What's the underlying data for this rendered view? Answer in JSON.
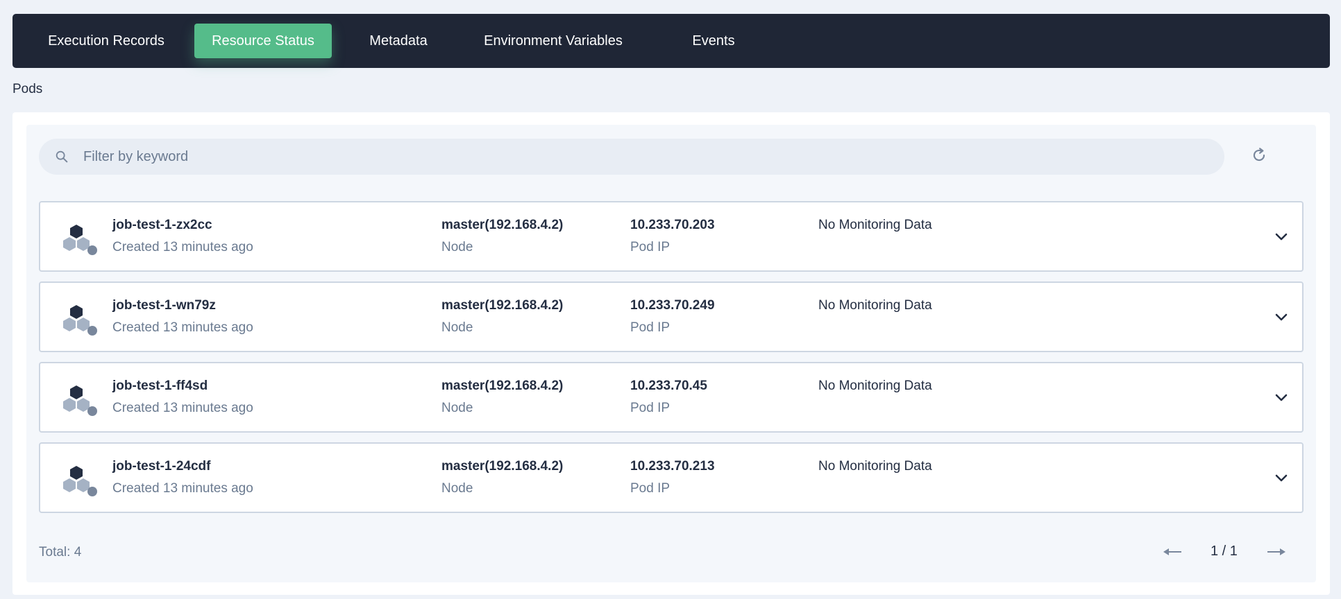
{
  "tabs": [
    {
      "label": "Execution Records"
    },
    {
      "label": "Resource Status"
    },
    {
      "label": "Metadata"
    },
    {
      "label": "Environment Variables"
    },
    {
      "label": "Events"
    }
  ],
  "section": {
    "title": "Pods"
  },
  "search": {
    "placeholder": "Filter by keyword",
    "value": ""
  },
  "pods": [
    {
      "name": "job-test-1-zx2cc",
      "created": "Created 13 minutes ago",
      "node": "master(192.168.4.2)",
      "node_label": "Node",
      "ip": "10.233.70.203",
      "ip_label": "Pod IP",
      "monitoring": "No Monitoring Data"
    },
    {
      "name": "job-test-1-wn79z",
      "created": "Created 13 minutes ago",
      "node": "master(192.168.4.2)",
      "node_label": "Node",
      "ip": "10.233.70.249",
      "ip_label": "Pod IP",
      "monitoring": "No Monitoring Data"
    },
    {
      "name": "job-test-1-ff4sd",
      "created": "Created 13 minutes ago",
      "node": "master(192.168.4.2)",
      "node_label": "Node",
      "ip": "10.233.70.45",
      "ip_label": "Pod IP",
      "monitoring": "No Monitoring Data"
    },
    {
      "name": "job-test-1-24cdf",
      "created": "Created 13 minutes ago",
      "node": "master(192.168.4.2)",
      "node_label": "Node",
      "ip": "10.233.70.213",
      "ip_label": "Pod IP",
      "monitoring": "No Monitoring Data"
    }
  ],
  "footer": {
    "total": "Total: 4",
    "page": "1 / 1"
  },
  "icons": {
    "search": "search-icon",
    "refresh": "refresh-icon",
    "pod": "pod-icon",
    "expand": "chevron-down-icon",
    "prev": "arrow-left-icon",
    "next": "arrow-right-icon"
  },
  "colors": {
    "tabbar": "#1f2636",
    "active_tab": "#55bc8a",
    "status_dot": "#79879c"
  }
}
